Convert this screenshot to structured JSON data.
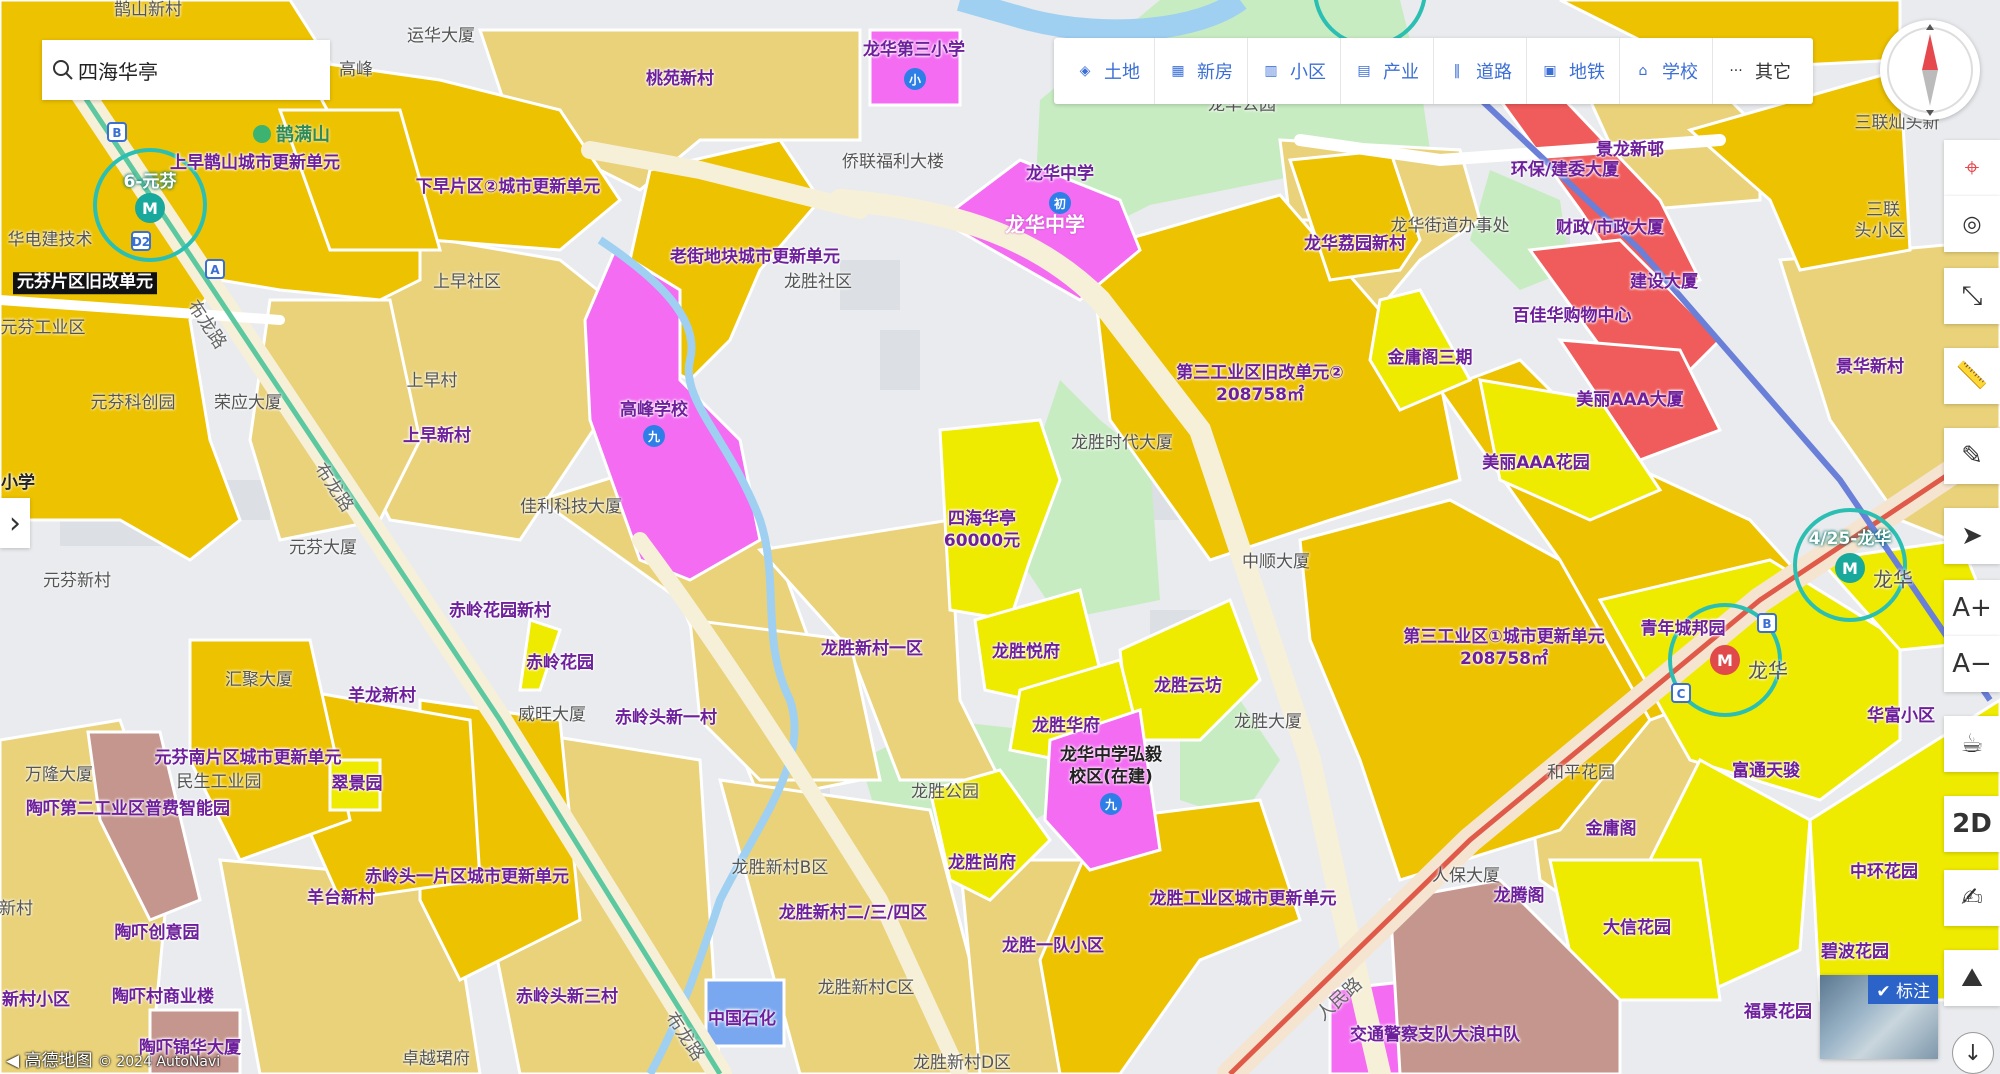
{
  "search": {
    "value": "四海华亭"
  },
  "layers": [
    {
      "label": "土地",
      "icon": "land-icon"
    },
    {
      "label": "新房",
      "icon": "new-house-icon"
    },
    {
      "label": "小区",
      "icon": "community-icon"
    },
    {
      "label": "产业",
      "icon": "industry-icon"
    },
    {
      "label": "道路",
      "icon": "road-icon"
    },
    {
      "label": "地铁",
      "icon": "metro-icon"
    },
    {
      "label": "学校",
      "icon": "school-icon"
    },
    {
      "label": "其它",
      "icon": "more-icon"
    }
  ],
  "tools": {
    "zoom_in": "A+",
    "zoom_out": "A−",
    "view_mode": "2D"
  },
  "annotation_toggle": {
    "label": "标注",
    "checked": true
  },
  "attribution": {
    "brand": "高德地图",
    "copyright": "© 2024 AutoNavi"
  },
  "colors": {
    "urban_renewal": "#edc200",
    "residential": "#e9d27a",
    "new_house": "#eeea00",
    "school": "#f36cf2",
    "commercial": "#f05b5b",
    "park": "#c8ecc2",
    "metro_ring": "#2bbfb3"
  },
  "map_labels": {
    "plots": [
      "龙华第三小学",
      "桃苑新村",
      "上早鹊山城市更新单元",
      "下早片区②城市更新单元",
      "老街地块城市更新单元",
      "龙华中学",
      "龙华中学",
      "龙华荔园新村",
      "环保/建委大厦",
      "景龙新邨",
      "财政/市政大厦",
      "建设大厦",
      "百佳华购物中心",
      "金庸阁三期",
      "第三工业区旧改单元②",
      "208758㎡",
      "高峰学校",
      "上早新村",
      "四海华亭",
      "60000元",
      "美丽AAA大厦",
      "美丽AAA花园",
      "景华新村",
      "4/25-龙华",
      "第三工业区①城市更新单元",
      "208758㎡",
      "青年城邦园",
      "华富小区",
      "赤岭花园新村",
      "赤岭花园",
      "羊龙新村",
      "赤岭头新一村",
      "龙胜新村一区",
      "龙胜悦府",
      "龙胜云坊",
      "龙胜华府",
      "龙华中学弘毅",
      "校区(在建)",
      "元芬南片区城市更新单元",
      "翠景园",
      "富通天骏",
      "陶吓第二工业区普费智能园",
      "赤岭头一片区城市更新单元",
      "羊台新村",
      "龙胜尚府",
      "金庸阁",
      "中环花园",
      "龙腾阁",
      "龙胜工业区城市更新单元",
      "大信花园",
      "碧波花园",
      "龙胜新村二/三/四区",
      "龙胜一队小区",
      "陶吓创意园",
      "陶吓村商业楼",
      "赤岭头新三村",
      "中国石化",
      "福景花园",
      "交通警察支队大浪中队",
      "陶吓锦华大厦",
      "新村小区",
      "元芬片区旧改单元"
    ],
    "plain": [
      "鹊山新村",
      "运华大厦",
      "高峰",
      "侨联福利大楼",
      "龙华公园",
      "三联灿头新",
      "龙华街道办事处",
      "上早社区",
      "龙胜社区",
      "元芬工业区",
      "上早村",
      "元芬科创园",
      "荣应大厦",
      "龙胜时代大厦",
      "佳利科技大厦",
      "元芬大厦",
      "中顺大厦",
      "元芬新村",
      "汇聚大厦",
      "威旺大厦",
      "龙胜大厦",
      "万隆大厦",
      "民生工业园",
      "龙胜公园",
      "和平花园",
      "人保大厦",
      "龙胜新村B区",
      "龙胜新村C区",
      "卓越珺府",
      "龙胜新村D区",
      "新村",
      "三联",
      "头小区",
      "华电建技术"
    ],
    "roads": [
      "布龙路",
      "布龙路",
      "布龙路",
      "人民路"
    ],
    "stations": [
      "6-元芬",
      "4/25-龙华"
    ],
    "pois": [
      "鹊满山",
      "龙华",
      "龙华",
      "小学"
    ]
  }
}
